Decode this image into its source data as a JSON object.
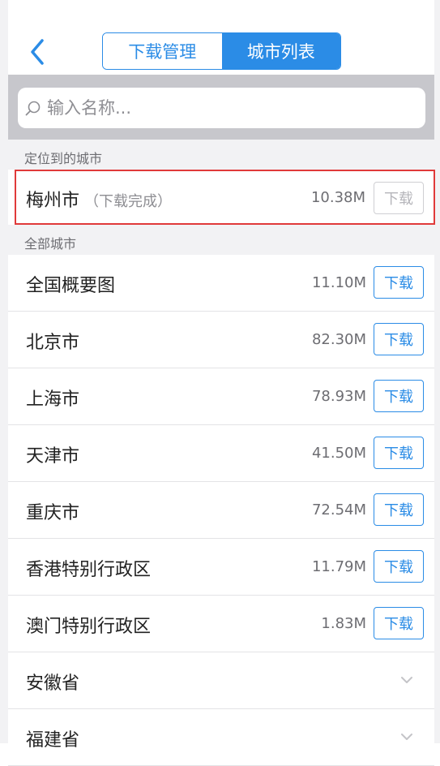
{
  "nav": {
    "tabs": [
      {
        "label": "下载管理",
        "active": false
      },
      {
        "label": "城市列表",
        "active": true
      }
    ]
  },
  "search": {
    "placeholder": "输入名称..."
  },
  "located_section": {
    "header": "定位到的城市",
    "city": {
      "name": "梅州市",
      "status": "（下载完成）",
      "size": "10.38M",
      "button": "下载"
    }
  },
  "all_section": {
    "header": "全部城市",
    "items": [
      {
        "name": "全国概要图",
        "size": "11.10M",
        "button": "下载"
      },
      {
        "name": "北京市",
        "size": "82.30M",
        "button": "下载"
      },
      {
        "name": "上海市",
        "size": "78.93M",
        "button": "下载"
      },
      {
        "name": "天津市",
        "size": "41.50M",
        "button": "下载"
      },
      {
        "name": "重庆市",
        "size": "72.54M",
        "button": "下载"
      },
      {
        "name": "香港特别行政区",
        "size": "11.79M",
        "button": "下载"
      },
      {
        "name": "澳门特别行政区",
        "size": "1.83M",
        "button": "下载"
      }
    ],
    "provinces": [
      {
        "name": "安徽省"
      },
      {
        "name": "福建省"
      }
    ]
  },
  "colors": {
    "accent": "#2b8ce6",
    "highlight": "#e03a3a"
  }
}
